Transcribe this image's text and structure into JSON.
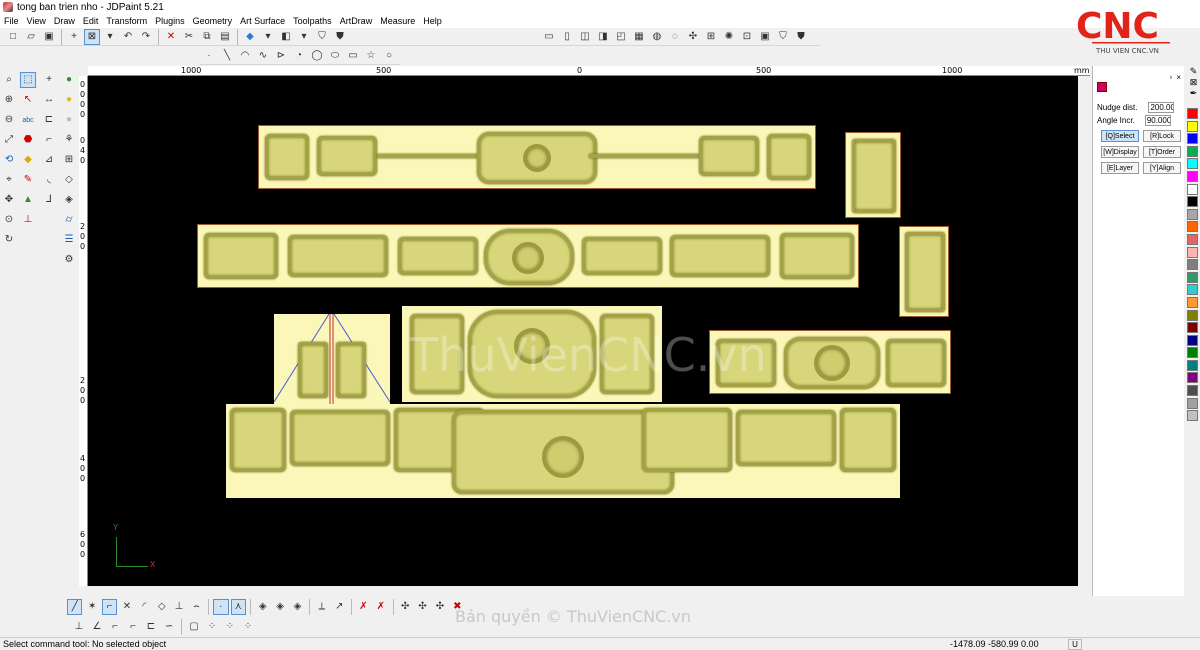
{
  "window": {
    "title": "tong ban trien nho - JDPaint 5.21"
  },
  "menu": [
    "File",
    "View",
    "Draw",
    "Edit",
    "Transform",
    "Plugins",
    "Geometry",
    "Art Surface",
    "Toolpaths",
    "ArtDraw",
    "Measure",
    "Help"
  ],
  "logo": {
    "text": "CNC",
    "subtitle": "THU VIEN CNC.VN",
    "color": "#e2231a"
  },
  "ruler": {
    "unit": "mm",
    "top_labels": [
      "1000",
      "500",
      "0",
      "500",
      "1000"
    ],
    "left_labels": [
      "0",
      "0",
      "0",
      "0",
      "0",
      "4",
      "0",
      "2",
      "0",
      "0",
      "2",
      "0",
      "0",
      "4",
      "0",
      "0",
      "6",
      "0",
      "0"
    ]
  },
  "canvas": {
    "watermark": "ThuVienCNC.vn",
    "axis": {
      "y_label": "Y",
      "x_label": "X"
    }
  },
  "right_panel": {
    "nudge_label": "Nudge dist.",
    "nudge_value": "200.000",
    "angle_label": "Angle Incr.",
    "angle_value": "90.000",
    "buttons": [
      "[Q]Select",
      "[R]Lock",
      "[W]Display",
      "[T]Order",
      "[E]Layer",
      "[Y]Align"
    ]
  },
  "palette": [
    "#ff0000",
    "#ffff00",
    "#0000ff",
    "#00b050",
    "#00ffff",
    "#ff00ff",
    "#ffffff",
    "#000000",
    "#a6a6a6",
    "#ff6600",
    "#e06666",
    "#ffb3b3",
    "#7f7f7f",
    "#339966",
    "#33cccc",
    "#ff9933",
    "#808000",
    "#800000",
    "#000080",
    "#008000",
    "#008080",
    "#800080",
    "#4d4d4d",
    "#a0a0a0",
    "#c0c0c0"
  ],
  "copyright": "Bản quyền © ThuVienCNC.vn",
  "status": {
    "text": "Select command tool: No selected object",
    "coords": "-1478.09 -580.99 0.00",
    "units": "U"
  }
}
